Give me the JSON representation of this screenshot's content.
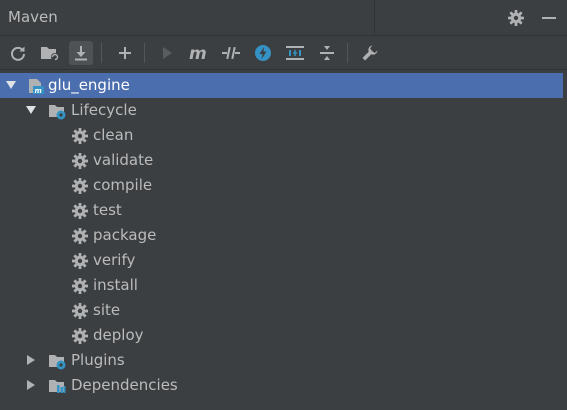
{
  "window": {
    "title": "Maven"
  },
  "header_icons": [
    "gear-icon",
    "minimize-icon"
  ],
  "toolbar": {
    "tools": [
      {
        "name": "reload-all-projects",
        "icon": "reload-icon"
      },
      {
        "name": "generate-sources",
        "icon": "folder-refresh-icon"
      },
      {
        "name": "download-sources",
        "icon": "download-icon",
        "active": true
      },
      {
        "name": "add-maven-project",
        "icon": "plus-icon"
      },
      {
        "name": "run-maven-build",
        "icon": "play-icon",
        "disabled": true
      },
      {
        "name": "execute-maven-goal",
        "icon": "m-icon"
      },
      {
        "name": "toggle-offline-mode",
        "icon": "offline-icon"
      },
      {
        "name": "skip-tests",
        "icon": "lightning-icon"
      },
      {
        "name": "show-dependencies",
        "icon": "diagram-icon"
      },
      {
        "name": "collapse-all",
        "icon": "collapse-icon"
      },
      {
        "name": "maven-settings",
        "icon": "wrench-icon"
      }
    ]
  },
  "tree": {
    "project": {
      "label": "glu_engine",
      "expanded": true,
      "selected": true
    },
    "lifecycle": {
      "label": "Lifecycle",
      "expanded": true,
      "phases": [
        "clean",
        "validate",
        "compile",
        "test",
        "package",
        "verify",
        "install",
        "site",
        "deploy"
      ]
    },
    "plugins": {
      "label": "Plugins",
      "expanded": false
    },
    "dependencies": {
      "label": "Dependencies",
      "expanded": false
    }
  },
  "colors": {
    "background": "#3c3f41",
    "selection": "#4b6eaf",
    "text": "#bbbbbb",
    "icon_blue": "#3592c4",
    "icon_gray": "#afb1b3"
  }
}
